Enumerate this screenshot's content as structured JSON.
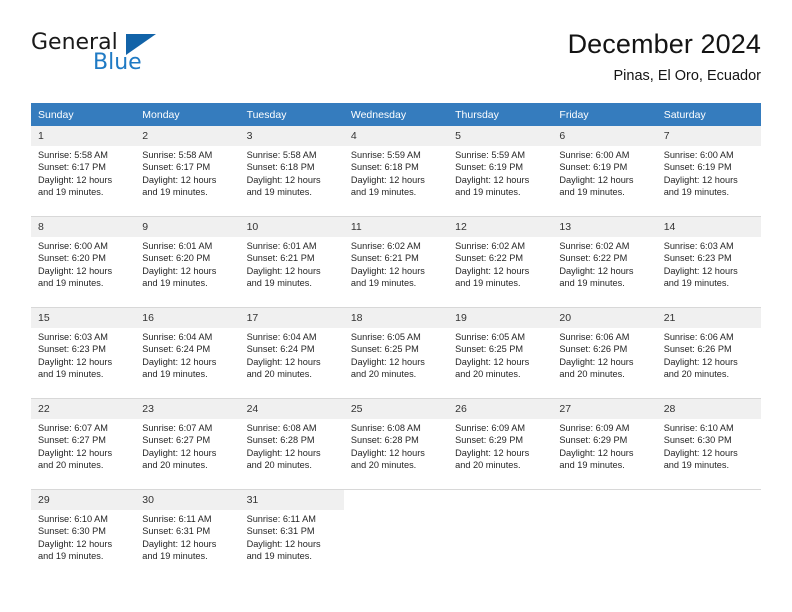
{
  "brand": {
    "name_part1": "General",
    "name_part2": "Blue",
    "triangle_color": "#1263a8",
    "blue_color": "#1f7ac4"
  },
  "header": {
    "title": "December 2024",
    "location": "Pinas, El Oro, Ecuador"
  },
  "theme": {
    "header_bg": "#357cbe",
    "daynum_bg": "#f0f0f0",
    "grid_line": "#d8d8d8"
  },
  "weekdays": [
    "Sunday",
    "Monday",
    "Tuesday",
    "Wednesday",
    "Thursday",
    "Friday",
    "Saturday"
  ],
  "weeks": [
    [
      {
        "day": "1",
        "sunrise": "Sunrise: 5:58 AM",
        "sunset": "Sunset: 6:17 PM",
        "daylight1": "Daylight: 12 hours",
        "daylight2": "and 19 minutes."
      },
      {
        "day": "2",
        "sunrise": "Sunrise: 5:58 AM",
        "sunset": "Sunset: 6:17 PM",
        "daylight1": "Daylight: 12 hours",
        "daylight2": "and 19 minutes."
      },
      {
        "day": "3",
        "sunrise": "Sunrise: 5:58 AM",
        "sunset": "Sunset: 6:18 PM",
        "daylight1": "Daylight: 12 hours",
        "daylight2": "and 19 minutes."
      },
      {
        "day": "4",
        "sunrise": "Sunrise: 5:59 AM",
        "sunset": "Sunset: 6:18 PM",
        "daylight1": "Daylight: 12 hours",
        "daylight2": "and 19 minutes."
      },
      {
        "day": "5",
        "sunrise": "Sunrise: 5:59 AM",
        "sunset": "Sunset: 6:19 PM",
        "daylight1": "Daylight: 12 hours",
        "daylight2": "and 19 minutes."
      },
      {
        "day": "6",
        "sunrise": "Sunrise: 6:00 AM",
        "sunset": "Sunset: 6:19 PM",
        "daylight1": "Daylight: 12 hours",
        "daylight2": "and 19 minutes."
      },
      {
        "day": "7",
        "sunrise": "Sunrise: 6:00 AM",
        "sunset": "Sunset: 6:19 PM",
        "daylight1": "Daylight: 12 hours",
        "daylight2": "and 19 minutes."
      }
    ],
    [
      {
        "day": "8",
        "sunrise": "Sunrise: 6:00 AM",
        "sunset": "Sunset: 6:20 PM",
        "daylight1": "Daylight: 12 hours",
        "daylight2": "and 19 minutes."
      },
      {
        "day": "9",
        "sunrise": "Sunrise: 6:01 AM",
        "sunset": "Sunset: 6:20 PM",
        "daylight1": "Daylight: 12 hours",
        "daylight2": "and 19 minutes."
      },
      {
        "day": "10",
        "sunrise": "Sunrise: 6:01 AM",
        "sunset": "Sunset: 6:21 PM",
        "daylight1": "Daylight: 12 hours",
        "daylight2": "and 19 minutes."
      },
      {
        "day": "11",
        "sunrise": "Sunrise: 6:02 AM",
        "sunset": "Sunset: 6:21 PM",
        "daylight1": "Daylight: 12 hours",
        "daylight2": "and 19 minutes."
      },
      {
        "day": "12",
        "sunrise": "Sunrise: 6:02 AM",
        "sunset": "Sunset: 6:22 PM",
        "daylight1": "Daylight: 12 hours",
        "daylight2": "and 19 minutes."
      },
      {
        "day": "13",
        "sunrise": "Sunrise: 6:02 AM",
        "sunset": "Sunset: 6:22 PM",
        "daylight1": "Daylight: 12 hours",
        "daylight2": "and 19 minutes."
      },
      {
        "day": "14",
        "sunrise": "Sunrise: 6:03 AM",
        "sunset": "Sunset: 6:23 PM",
        "daylight1": "Daylight: 12 hours",
        "daylight2": "and 19 minutes."
      }
    ],
    [
      {
        "day": "15",
        "sunrise": "Sunrise: 6:03 AM",
        "sunset": "Sunset: 6:23 PM",
        "daylight1": "Daylight: 12 hours",
        "daylight2": "and 19 minutes."
      },
      {
        "day": "16",
        "sunrise": "Sunrise: 6:04 AM",
        "sunset": "Sunset: 6:24 PM",
        "daylight1": "Daylight: 12 hours",
        "daylight2": "and 19 minutes."
      },
      {
        "day": "17",
        "sunrise": "Sunrise: 6:04 AM",
        "sunset": "Sunset: 6:24 PM",
        "daylight1": "Daylight: 12 hours",
        "daylight2": "and 20 minutes."
      },
      {
        "day": "18",
        "sunrise": "Sunrise: 6:05 AM",
        "sunset": "Sunset: 6:25 PM",
        "daylight1": "Daylight: 12 hours",
        "daylight2": "and 20 minutes."
      },
      {
        "day": "19",
        "sunrise": "Sunrise: 6:05 AM",
        "sunset": "Sunset: 6:25 PM",
        "daylight1": "Daylight: 12 hours",
        "daylight2": "and 20 minutes."
      },
      {
        "day": "20",
        "sunrise": "Sunrise: 6:06 AM",
        "sunset": "Sunset: 6:26 PM",
        "daylight1": "Daylight: 12 hours",
        "daylight2": "and 20 minutes."
      },
      {
        "day": "21",
        "sunrise": "Sunrise: 6:06 AM",
        "sunset": "Sunset: 6:26 PM",
        "daylight1": "Daylight: 12 hours",
        "daylight2": "and 20 minutes."
      }
    ],
    [
      {
        "day": "22",
        "sunrise": "Sunrise: 6:07 AM",
        "sunset": "Sunset: 6:27 PM",
        "daylight1": "Daylight: 12 hours",
        "daylight2": "and 20 minutes."
      },
      {
        "day": "23",
        "sunrise": "Sunrise: 6:07 AM",
        "sunset": "Sunset: 6:27 PM",
        "daylight1": "Daylight: 12 hours",
        "daylight2": "and 20 minutes."
      },
      {
        "day": "24",
        "sunrise": "Sunrise: 6:08 AM",
        "sunset": "Sunset: 6:28 PM",
        "daylight1": "Daylight: 12 hours",
        "daylight2": "and 20 minutes."
      },
      {
        "day": "25",
        "sunrise": "Sunrise: 6:08 AM",
        "sunset": "Sunset: 6:28 PM",
        "daylight1": "Daylight: 12 hours",
        "daylight2": "and 20 minutes."
      },
      {
        "day": "26",
        "sunrise": "Sunrise: 6:09 AM",
        "sunset": "Sunset: 6:29 PM",
        "daylight1": "Daylight: 12 hours",
        "daylight2": "and 20 minutes."
      },
      {
        "day": "27",
        "sunrise": "Sunrise: 6:09 AM",
        "sunset": "Sunset: 6:29 PM",
        "daylight1": "Daylight: 12 hours",
        "daylight2": "and 19 minutes."
      },
      {
        "day": "28",
        "sunrise": "Sunrise: 6:10 AM",
        "sunset": "Sunset: 6:30 PM",
        "daylight1": "Daylight: 12 hours",
        "daylight2": "and 19 minutes."
      }
    ],
    [
      {
        "day": "29",
        "sunrise": "Sunrise: 6:10 AM",
        "sunset": "Sunset: 6:30 PM",
        "daylight1": "Daylight: 12 hours",
        "daylight2": "and 19 minutes."
      },
      {
        "day": "30",
        "sunrise": "Sunrise: 6:11 AM",
        "sunset": "Sunset: 6:31 PM",
        "daylight1": "Daylight: 12 hours",
        "daylight2": "and 19 minutes."
      },
      {
        "day": "31",
        "sunrise": "Sunrise: 6:11 AM",
        "sunset": "Sunset: 6:31 PM",
        "daylight1": "Daylight: 12 hours",
        "daylight2": "and 19 minutes."
      },
      {
        "day": "",
        "sunrise": "",
        "sunset": "",
        "daylight1": "",
        "daylight2": ""
      },
      {
        "day": "",
        "sunrise": "",
        "sunset": "",
        "daylight1": "",
        "daylight2": ""
      },
      {
        "day": "",
        "sunrise": "",
        "sunset": "",
        "daylight1": "",
        "daylight2": ""
      },
      {
        "day": "",
        "sunrise": "",
        "sunset": "",
        "daylight1": "",
        "daylight2": ""
      }
    ]
  ]
}
